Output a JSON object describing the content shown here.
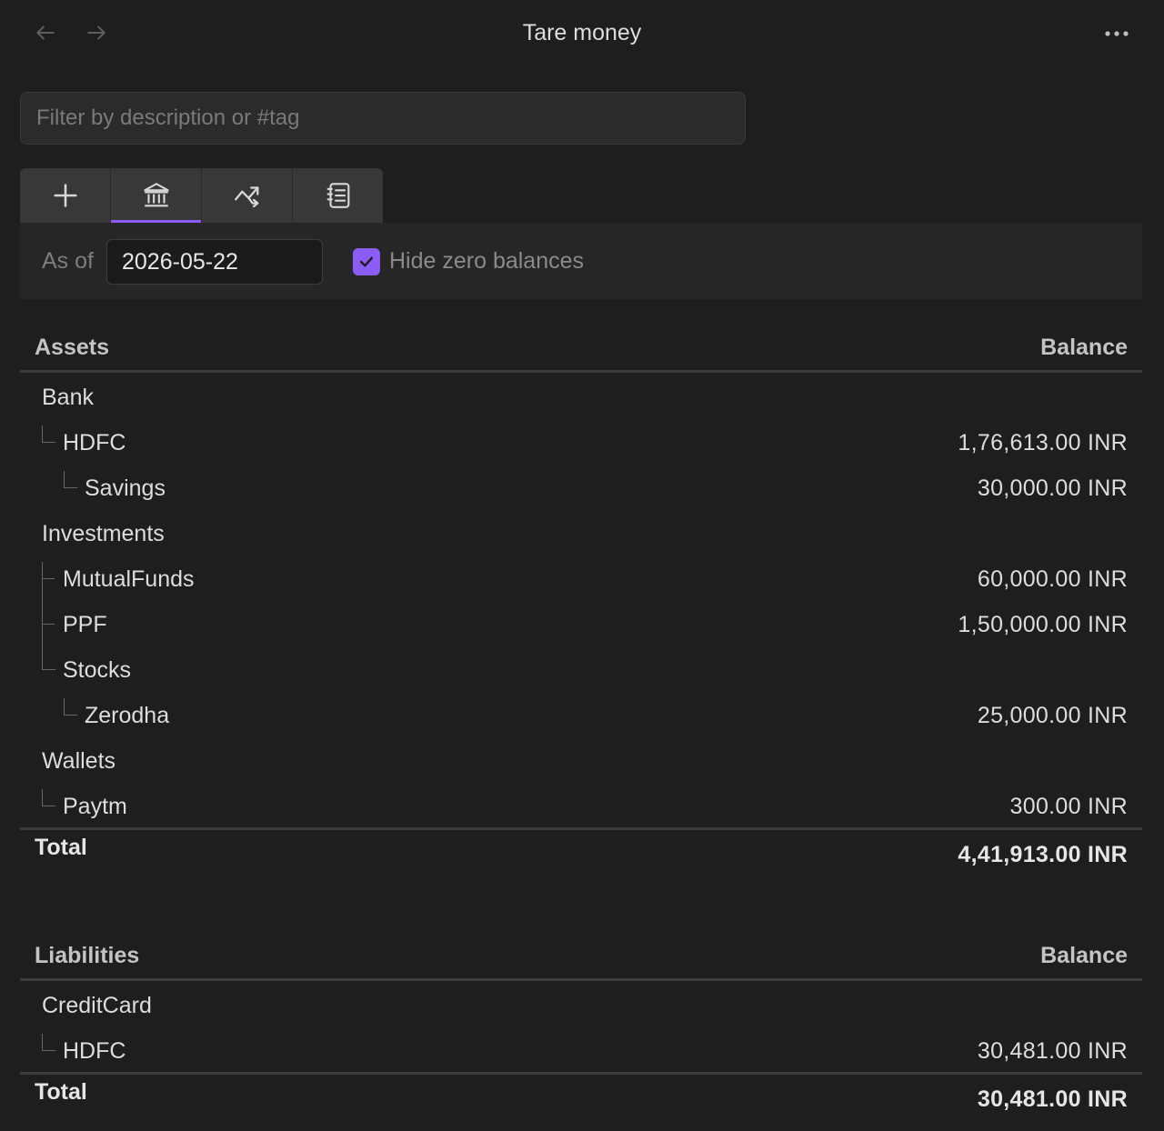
{
  "header": {
    "title": "Tare money",
    "back_icon": "arrow-left-icon",
    "forward_icon": "arrow-right-icon",
    "more_icon": "more-horizontal-icon"
  },
  "filter": {
    "placeholder": "Filter by description or #tag",
    "value": ""
  },
  "tabs": [
    {
      "icon": "plus-icon",
      "active": false
    },
    {
      "icon": "bank-icon",
      "active": true
    },
    {
      "icon": "trend-icon",
      "active": false
    },
    {
      "icon": "ledger-icon",
      "active": false
    }
  ],
  "options": {
    "as_of_label": "As of",
    "date": "2026-05-22",
    "hide_zero_label": "Hide zero balances",
    "hide_zero_checked": true
  },
  "colors": {
    "accent": "#8b5cf6",
    "background": "#1e1e1e"
  },
  "assets": {
    "heading": "Assets",
    "balance_heading": "Balance",
    "rows": [
      {
        "name": "Bank",
        "balance": ""
      },
      {
        "name": "HDFC",
        "balance": "1,76,613.00 INR"
      },
      {
        "name": "Savings",
        "balance": "30,000.00 INR"
      },
      {
        "name": "Investments",
        "balance": ""
      },
      {
        "name": "MutualFunds",
        "balance": "60,000.00 INR"
      },
      {
        "name": "PPF",
        "balance": "1,50,000.00 INR"
      },
      {
        "name": "Stocks",
        "balance": ""
      },
      {
        "name": "Zerodha",
        "balance": "25,000.00 INR"
      },
      {
        "name": "Wallets",
        "balance": ""
      },
      {
        "name": "Paytm",
        "balance": "300.00 INR"
      }
    ],
    "total_label": "Total",
    "total": "4,41,913.00 INR"
  },
  "liabilities": {
    "heading": "Liabilities",
    "balance_heading": "Balance",
    "rows": [
      {
        "name": "CreditCard",
        "balance": ""
      },
      {
        "name": "HDFC",
        "balance": "30,481.00 INR"
      }
    ],
    "total_label": "Total",
    "total": "30,481.00 INR"
  }
}
